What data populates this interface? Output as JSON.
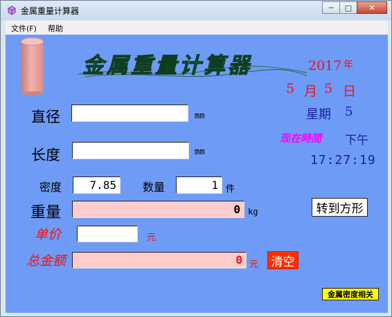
{
  "window": {
    "title": "金属重量计算器",
    "controls": {
      "minimize": "─",
      "maximize": "□",
      "close": "✕"
    }
  },
  "menu": {
    "file": "文件(F)",
    "help": "帮助"
  },
  "logo": {
    "text": "金属重量计算器"
  },
  "date": {
    "year": "2017",
    "year_unit": "年",
    "month": "5",
    "month_unit": "月",
    "day": "5",
    "day_unit": "日",
    "weekday_label": "星期",
    "weekday": "5"
  },
  "clock": {
    "label": "现在時間",
    "ampm": "下午",
    "time": "17:27:19"
  },
  "inputs": {
    "diameter": {
      "label": "直径",
      "value": "",
      "unit": "mm"
    },
    "length": {
      "label": "长度",
      "value": "",
      "unit": "mm"
    },
    "density": {
      "label": "密度",
      "value": "7.85"
    },
    "quantity": {
      "label": "数量",
      "value": "1",
      "unit": "件"
    },
    "unit_price": {
      "label": "单价",
      "value": "",
      "unit": "元"
    }
  },
  "outputs": {
    "weight": {
      "label": "重量",
      "value": "0",
      "unit": "kg"
    },
    "total": {
      "label": "总金额",
      "value": "0",
      "unit": "元"
    }
  },
  "buttons": {
    "to_square": "转到方形",
    "clear": "清空",
    "density_info": "金属密度相关"
  },
  "colors": {
    "client_bg": "#6e9bf6",
    "date_red": "#e8141b",
    "weekday_navy": "#1a1f9c",
    "clock_label": "#ff00ff",
    "result_field": "#ffcccc",
    "clear_button": "#ff2e00",
    "density_button": "#ffff00"
  }
}
